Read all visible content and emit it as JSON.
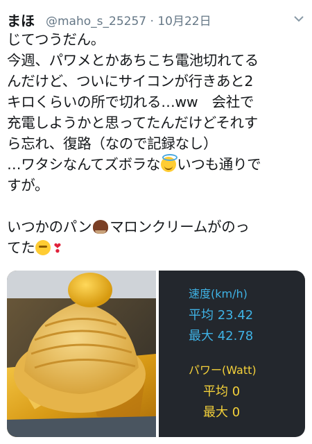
{
  "tweet": {
    "author_name": "まほ",
    "handle": "@maho_s_25257",
    "separator": "·",
    "date": "10月22日",
    "lines": [
      "じてつうだん。",
      "今週、パワメとかあちこち電池切れてる",
      "んだけど、ついにサイコンが行きあと2",
      "キロくらいの所で切れる…ww　会社で",
      "充電しようかと思ってたんだけどそれす",
      "ら忘れ、復路（なので記録なし）",
      "…ワタシなんてズボラな",
      "いつも通りで",
      "すが。",
      "いつかのパン",
      "マロンクリームがのっ",
      "てた"
    ],
    "emoji": [
      "innocent-halo-face",
      "chestnut",
      "relieved-face",
      "red-heart"
    ],
    "colors": {
      "handle": "#657786",
      "text": "#14171a",
      "speed": "#3fb3e6",
      "power": "#f4d13a",
      "panel": "#23272d"
    }
  },
  "stats": {
    "speed_title": "速度(km/h)",
    "speed_avg": "平均 23.42",
    "speed_max": "最大 42.78",
    "power_title": "パワー(Watt)",
    "power_avg": "平均 0",
    "power_max": "最大 0"
  }
}
